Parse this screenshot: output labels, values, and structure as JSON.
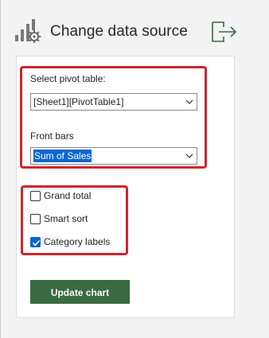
{
  "header": {
    "title": "Change data source",
    "app_icon": "chart-gear-icon",
    "exit_icon": "sign-out-icon"
  },
  "form": {
    "pivot": {
      "label": "Select pivot table:",
      "value": "[Sheet1][PivotTable1]"
    },
    "front_bars": {
      "label": "Front bars",
      "value": "Sum of Sales"
    },
    "options": [
      {
        "label": "Grand total",
        "checked": false
      },
      {
        "label": "Smart sort",
        "checked": false
      },
      {
        "label": "Category labels",
        "checked": true
      }
    ],
    "update_button": "Update chart"
  },
  "colors": {
    "accent_green": "#3a6b41",
    "highlight_red": "#d0242c",
    "selection_blue": "#0b66cf"
  }
}
